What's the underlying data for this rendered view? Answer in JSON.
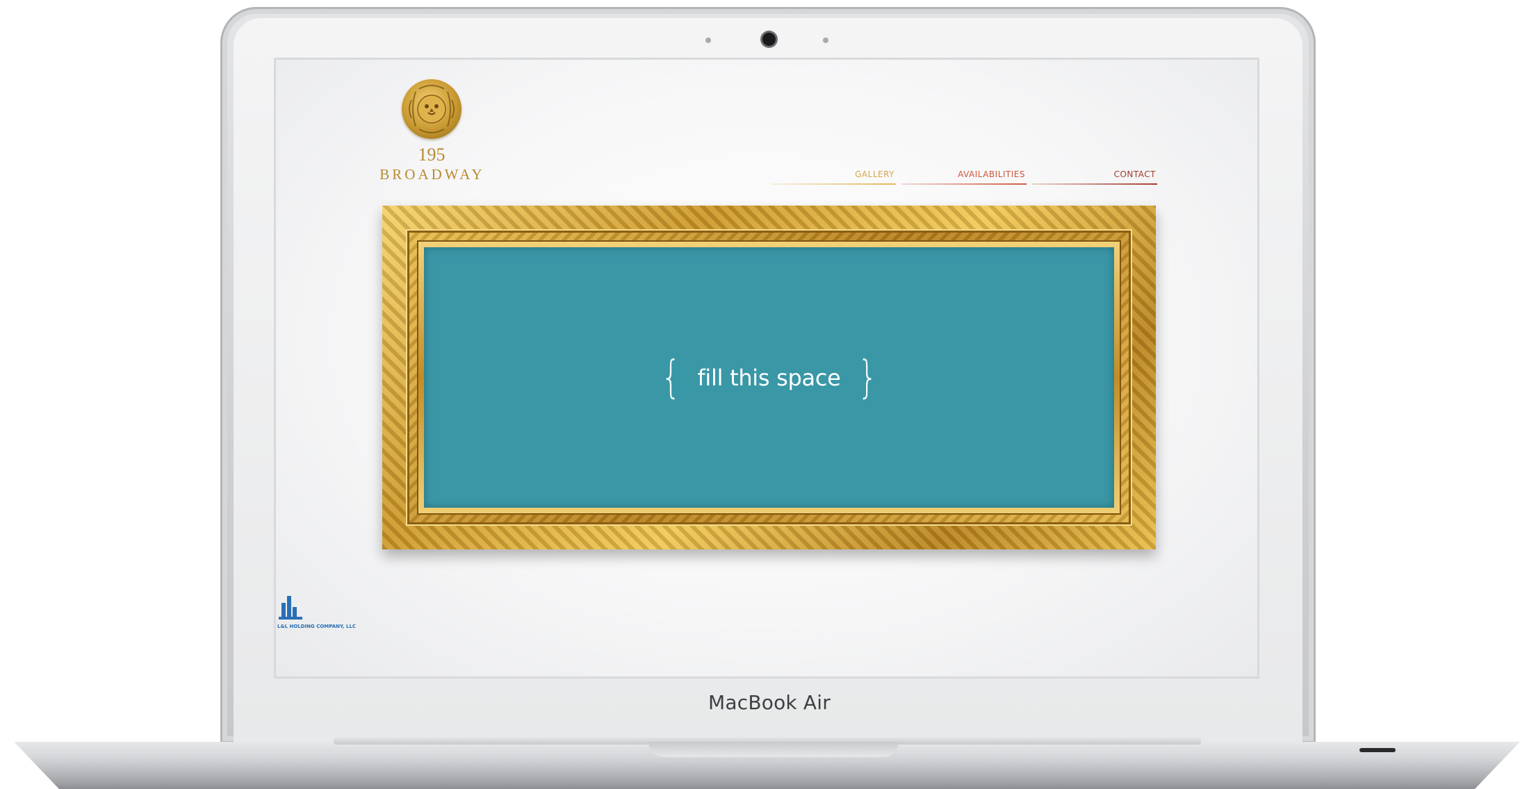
{
  "device": {
    "label": "MacBook Air"
  },
  "site": {
    "logo_number": "195",
    "logo_name": "BROADWAY",
    "nav": [
      {
        "label": "GALLERY",
        "color": "#d3a84a"
      },
      {
        "label": "AVAILABILITIES",
        "color": "#c9573c"
      },
      {
        "label": "CONTACT",
        "color": "#a43a2a"
      }
    ],
    "hero": {
      "text": "fill this space",
      "left_brace": "{",
      "right_brace": "}",
      "background_color": "#3a97a6"
    },
    "footer": {
      "company_name": "L&L HOLDING COMPANY, LLC"
    }
  },
  "icons": [
    "lion-head-logo-icon",
    "company-building-logo-icon",
    "camera-icon"
  ]
}
